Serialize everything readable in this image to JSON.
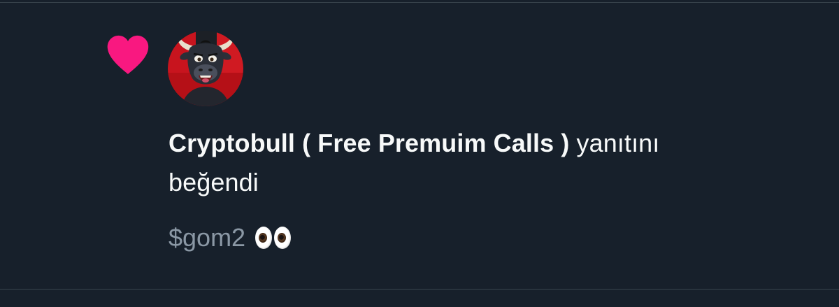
{
  "notification": {
    "type_icon": "heart-icon",
    "avatar_icon": "bull-avatar-icon",
    "user_name": "Cryptobull ( Free Premuim Calls )",
    "action_text_1": " yanıtını",
    "action_text_2": "beğendi",
    "liked_text": "$gom2",
    "emoji": "eyes-emoji"
  },
  "colors": {
    "background": "#17202b",
    "heart": "#f91880",
    "primary_text": "#f7f9f9",
    "secondary_text": "#8b98a5",
    "divider": "#38444d"
  }
}
